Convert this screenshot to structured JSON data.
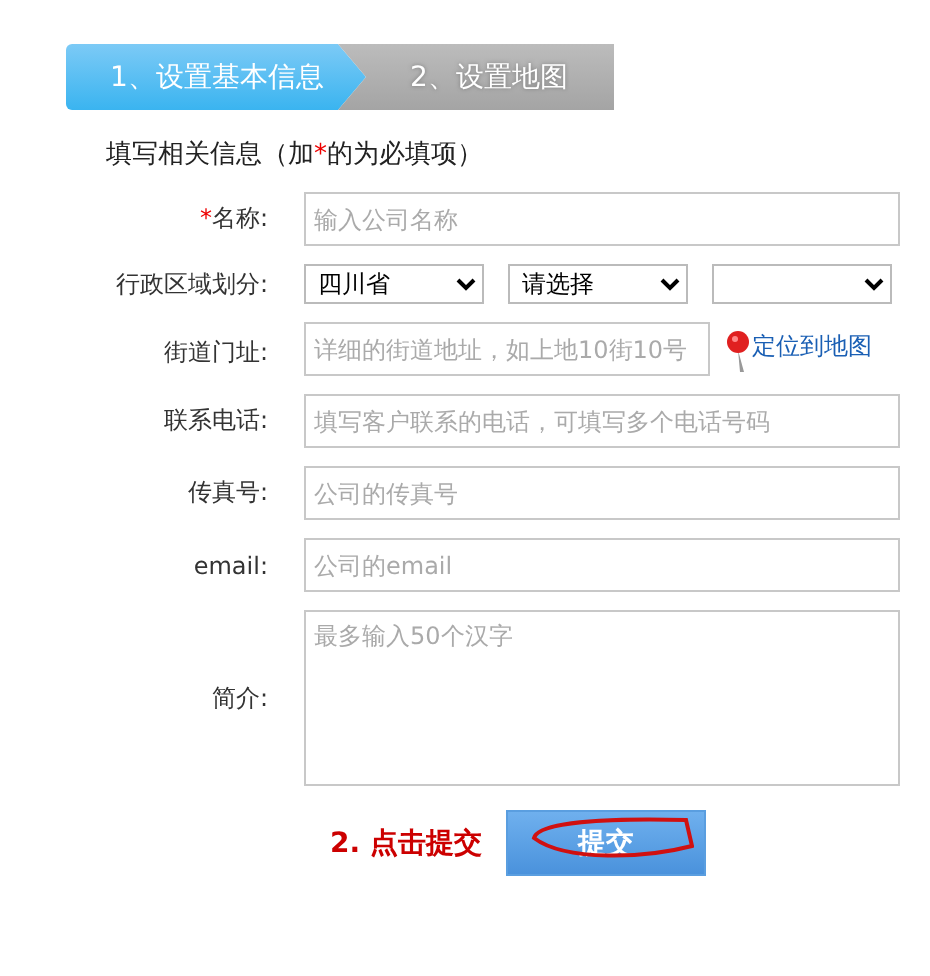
{
  "steps": [
    {
      "label": "1、设置基本信息",
      "selected": true
    },
    {
      "label": "2、设置地图",
      "selected": false
    }
  ],
  "heading": {
    "before": "填写相关信息（加",
    "mark": "*",
    "after": "的为必填项）"
  },
  "fields": [
    {
      "kind": "text",
      "mark": "*",
      "label": "名称:",
      "placeholder": "输入公司名称"
    },
    {
      "kind": "selects",
      "label": "行政区域划分:",
      "selects": [
        {
          "value": "四川省"
        },
        {
          "value": "请选择"
        },
        {
          "blank": true
        }
      ]
    },
    {
      "kind": "address",
      "label": "街道门址:",
      "placeholder": "详细的街道地址，如上地10街10号",
      "link": "定位到地图"
    },
    {
      "kind": "text",
      "label": "联系电话:",
      "placeholder": "填写客户联系的电话，可填写多个电话号码"
    },
    {
      "kind": "text",
      "label": "传真号:",
      "placeholder": "公司的传真号"
    },
    {
      "kind": "text",
      "label": "email:",
      "placeholder": "公司的email"
    },
    {
      "kind": "textarea",
      "label": "简介:",
      "placeholder": "最多输入50个汉字"
    }
  ],
  "annotation": "2. 点击提交",
  "submit": "提交"
}
